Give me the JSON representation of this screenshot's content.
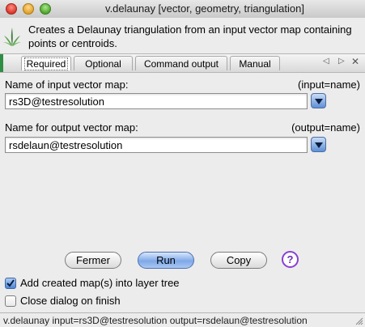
{
  "window": {
    "title": "v.delaunay [vector, geometry, triangulation]"
  },
  "header": {
    "description": "Creates a Delaunay triangulation from an input vector map containing points or centroids."
  },
  "tabs": [
    {
      "label": "Required",
      "active": true
    },
    {
      "label": "Optional",
      "active": false
    },
    {
      "label": "Command output",
      "active": false
    },
    {
      "label": "Manual",
      "active": false
    }
  ],
  "tab_nav": {
    "left_icon": "triangle-left-icon",
    "right_icon": "triangle-right-icon",
    "close_icon": "close-icon"
  },
  "form": {
    "input": {
      "label": "Name of input vector map:",
      "param": "(input=name)",
      "value": "rs3D@testresolution"
    },
    "output": {
      "label": "Name for output vector map:",
      "param": "(output=name)",
      "value": "rsdelaun@testresolution"
    }
  },
  "buttons": {
    "close": "Fermer",
    "run": "Run",
    "copy": "Copy",
    "help": "?"
  },
  "options": {
    "add_to_tree": {
      "label": "Add created map(s) into layer tree",
      "checked": true
    },
    "close_on_finish": {
      "label": "Close dialog on finish",
      "checked": false
    }
  },
  "statusbar": {
    "text": "v.delaunay input=rs3D@testresolution output=rsdelaun@testresolution"
  },
  "colors": {
    "accent_green": "#2f8e43",
    "default_button_blue": "#7ea9e8",
    "help_purple": "#8a3fd1"
  }
}
